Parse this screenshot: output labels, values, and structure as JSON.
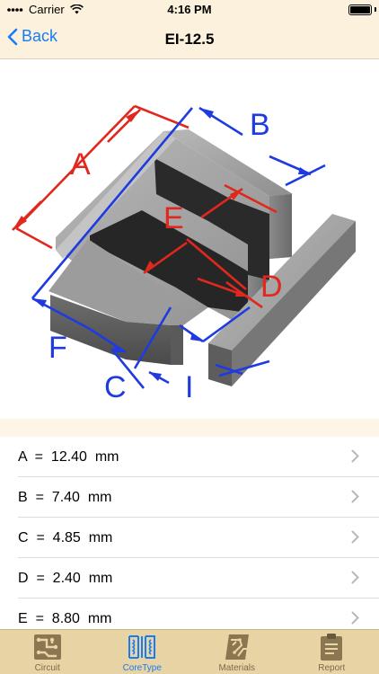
{
  "status": {
    "carrier": "Carrier",
    "time": "4:16 PM"
  },
  "nav": {
    "back_label": "Back",
    "title": "EI-12.5"
  },
  "diagram": {
    "labels": {
      "A": "A",
      "B": "B",
      "C": "C",
      "D": "D",
      "E": "E",
      "F": "F",
      "I": "I"
    },
    "colors": {
      "red": "#e0281e",
      "blue": "#1f3be0"
    }
  },
  "dimensions": [
    {
      "label": "A  =  12.40  mm"
    },
    {
      "label": "B  =  7.40  mm"
    },
    {
      "label": "C  =  4.85  mm"
    },
    {
      "label": "D  =  2.40  mm"
    },
    {
      "label": "E  =  8.80  mm"
    }
  ],
  "tabs": [
    {
      "label": "Circuit",
      "icon": "circuit-icon"
    },
    {
      "label": "CoreType",
      "icon": "coretype-icon",
      "active": true
    },
    {
      "label": "Materials",
      "icon": "materials-icon"
    },
    {
      "label": "Report",
      "icon": "report-icon"
    }
  ],
  "colors": {
    "accent": "#1a7cf5",
    "bar_bg": "#fbf1dc",
    "tab_bg": "#e7d3a4"
  }
}
